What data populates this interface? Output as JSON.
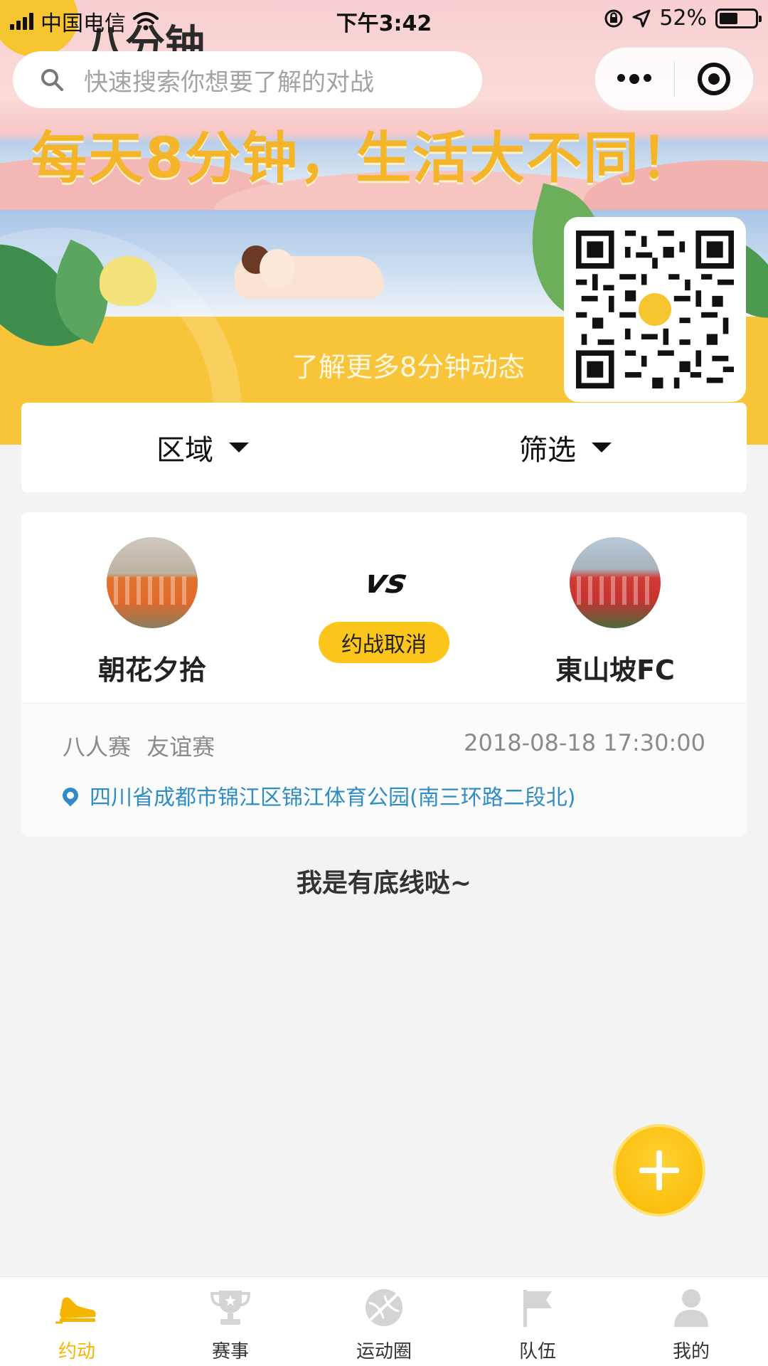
{
  "status_bar": {
    "carrier": "中国电信",
    "time": "下午3:42",
    "battery": "52%",
    "battery_level": 0.52
  },
  "banner": {
    "logo_text": "八分钟",
    "slogan": "每天8分钟，生活大不同！",
    "subtitle": "了解更多8分钟动态"
  },
  "search": {
    "placeholder": "快速搜索你想要了解的对战"
  },
  "filters": {
    "region_label": "区域",
    "filter_label": "筛选"
  },
  "match": {
    "home_team": "朝花夕拾",
    "away_team": "東山坡FC",
    "vs": "vs",
    "status": "约战取消",
    "type": "八人赛 友谊赛",
    "time": "2018-08-18 17:30:00",
    "location": "四川省成都市锦江区锦江体育公园(南三环路二段北)"
  },
  "footer_note": "我是有底线哒~",
  "tabs": [
    {
      "label": "约动",
      "icon": "sneaker-icon",
      "active": true
    },
    {
      "label": "赛事",
      "icon": "trophy-icon",
      "active": false
    },
    {
      "label": "运动圈",
      "icon": "ball-icon",
      "active": false
    },
    {
      "label": "队伍",
      "icon": "flag-icon",
      "active": false
    },
    {
      "label": "我的",
      "icon": "user-icon",
      "active": false
    }
  ],
  "colors": {
    "accent": "#fcc51b",
    "active_tab": "#f5b400",
    "link": "#2f8dc4"
  }
}
